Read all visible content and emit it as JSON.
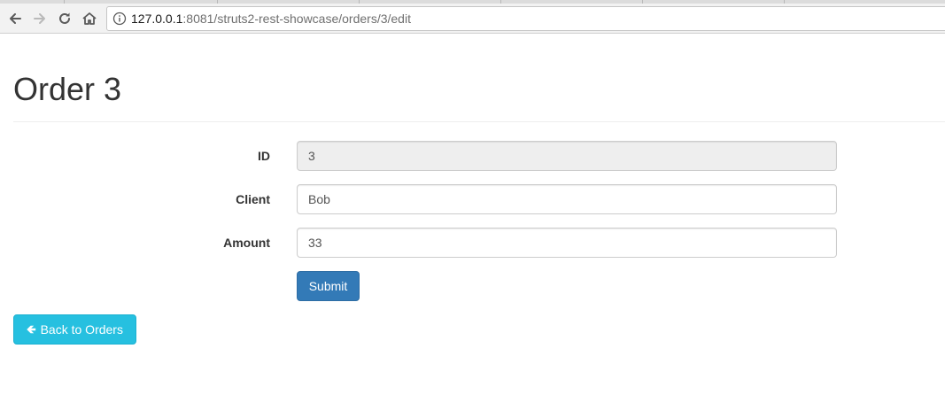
{
  "browser": {
    "url_host": "127.0.0.1",
    "url_rest": ":8081/struts2-rest-showcase/orders/3/edit",
    "icons": {
      "back": "back-arrow-icon",
      "forward": "forward-arrow-icon",
      "reload": "reload-icon",
      "home": "home-icon",
      "site_info": "info-icon"
    }
  },
  "page": {
    "title": "Order 3"
  },
  "form": {
    "id": {
      "label": "ID",
      "value": "3",
      "readonly": true
    },
    "client": {
      "label": "Client",
      "value": "Bob"
    },
    "amount": {
      "label": "Amount",
      "value": "33"
    },
    "submit_label": "Submit"
  },
  "back_button": {
    "label": "Back to Orders",
    "icon": "arrow-left-icon"
  },
  "colors": {
    "primary": "#337ab7",
    "info": "#26c0e0",
    "readonly_bg": "#eeeeee",
    "text": "#333333"
  }
}
